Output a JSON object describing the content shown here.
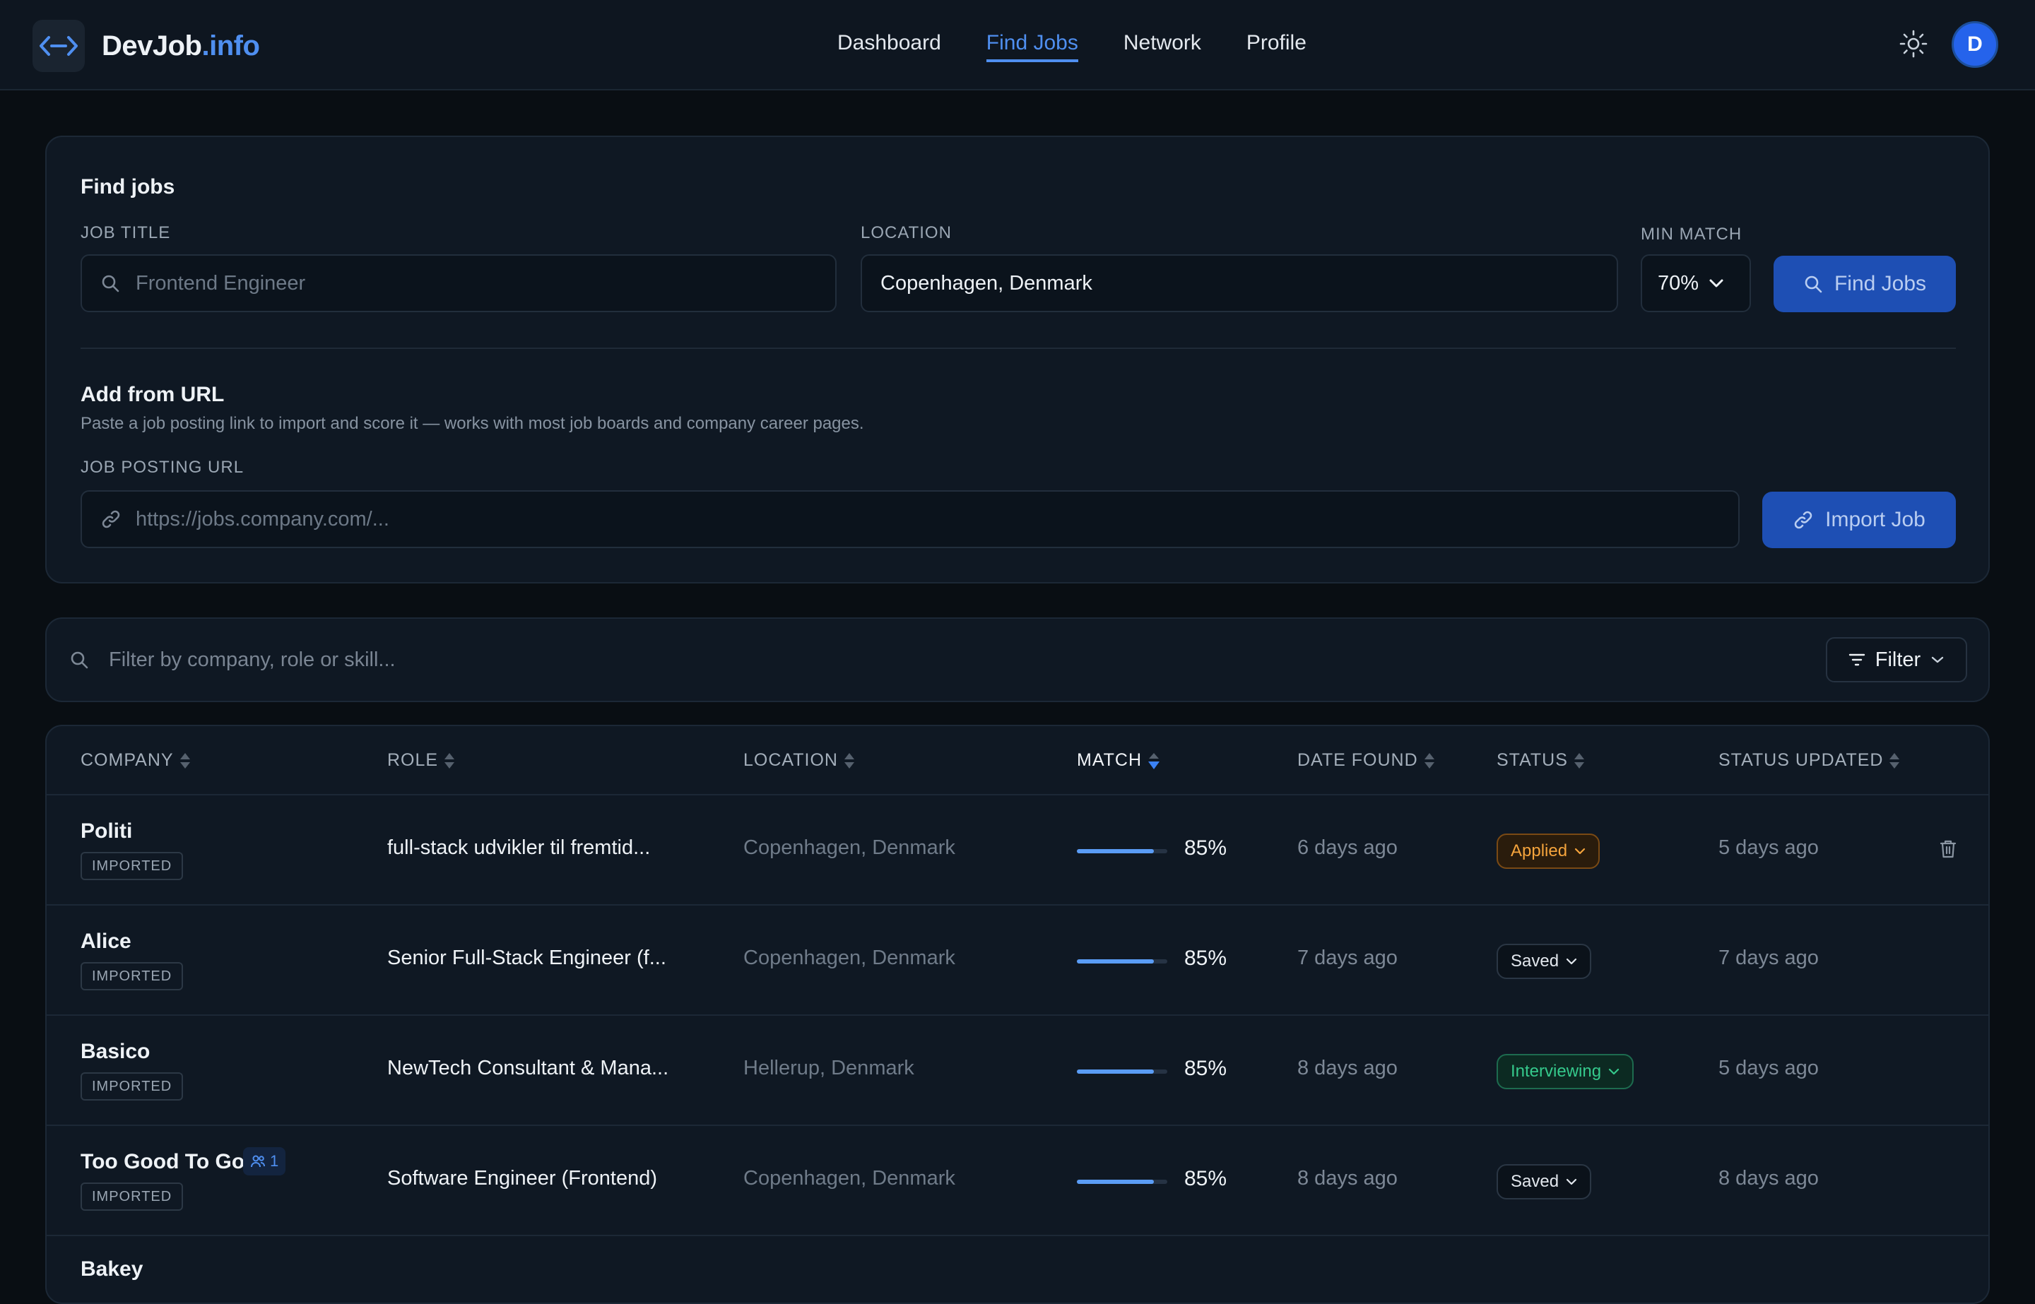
{
  "brand": {
    "name": "DevJob",
    "suffix": ".info"
  },
  "nav": [
    {
      "label": "Dashboard",
      "active": false
    },
    {
      "label": "Find Jobs",
      "active": true
    },
    {
      "label": "Network",
      "active": false
    },
    {
      "label": "Profile",
      "active": false
    }
  ],
  "user": {
    "initial": "D"
  },
  "search": {
    "title": "Find jobs",
    "job_title_label": "JOB TITLE",
    "job_title_placeholder": "Frontend Engineer",
    "location_label": "LOCATION",
    "location_value": "Copenhagen, Denmark",
    "min_match_label": "MIN MATCH",
    "min_match_value": "70%",
    "find_button": "Find Jobs"
  },
  "import": {
    "title": "Add from URL",
    "helper": "Paste a job posting link to import and score it — works with most job boards and company career pages.",
    "url_label": "JOB POSTING URL",
    "url_placeholder": "https://jobs.company.com/...",
    "import_button": "Import Job"
  },
  "filter": {
    "placeholder": "Filter by company, role or skill...",
    "button": "Filter"
  },
  "table": {
    "columns": [
      "COMPANY",
      "ROLE",
      "LOCATION",
      "MATCH",
      "DATE FOUND",
      "STATUS",
      "STATUS UPDATED"
    ],
    "sorted_column": "MATCH",
    "rows": [
      {
        "company": "Politi",
        "tag": "IMPORTED",
        "role": "full-stack udvikler til fremtid...",
        "location": "Copenhagen, Denmark",
        "match": "85%",
        "match_value": 0.85,
        "date_found": "6 days ago",
        "status": "Applied",
        "status_kind": "applied",
        "status_updated": "5 days ago",
        "network_count": null
      },
      {
        "company": "Alice",
        "tag": "IMPORTED",
        "role": "Senior Full-Stack Engineer (f...",
        "location": "Copenhagen, Denmark",
        "match": "85%",
        "match_value": 0.85,
        "date_found": "7 days ago",
        "status": "Saved",
        "status_kind": "saved",
        "status_updated": "7 days ago",
        "network_count": null
      },
      {
        "company": "Basico",
        "tag": "IMPORTED",
        "role": "NewTech Consultant & Mana...",
        "location": "Hellerup, Denmark",
        "match": "85%",
        "match_value": 0.85,
        "date_found": "8 days ago",
        "status": "Interviewing",
        "status_kind": "interviewing",
        "status_updated": "5 days ago",
        "network_count": null
      },
      {
        "company": "Too Good To Go",
        "tag": "IMPORTED",
        "role": "Software Engineer (Frontend)",
        "location": "Copenhagen, Denmark",
        "match": "85%",
        "match_value": 0.85,
        "date_found": "8 days ago",
        "status": "Saved",
        "status_kind": "saved",
        "status_updated": "8 days ago",
        "network_count": "1"
      },
      {
        "company": "Bakey",
        "tag": "",
        "role": "",
        "location": "",
        "match": "",
        "match_value": null,
        "date_found": "",
        "status": "",
        "status_kind": "",
        "status_updated": "",
        "network_count": null
      }
    ]
  },
  "colors": {
    "accent": "#4f8ff0",
    "primary_button": "#1e4fb4",
    "applied": "#f5a43c",
    "interviewing": "#35c98c"
  }
}
